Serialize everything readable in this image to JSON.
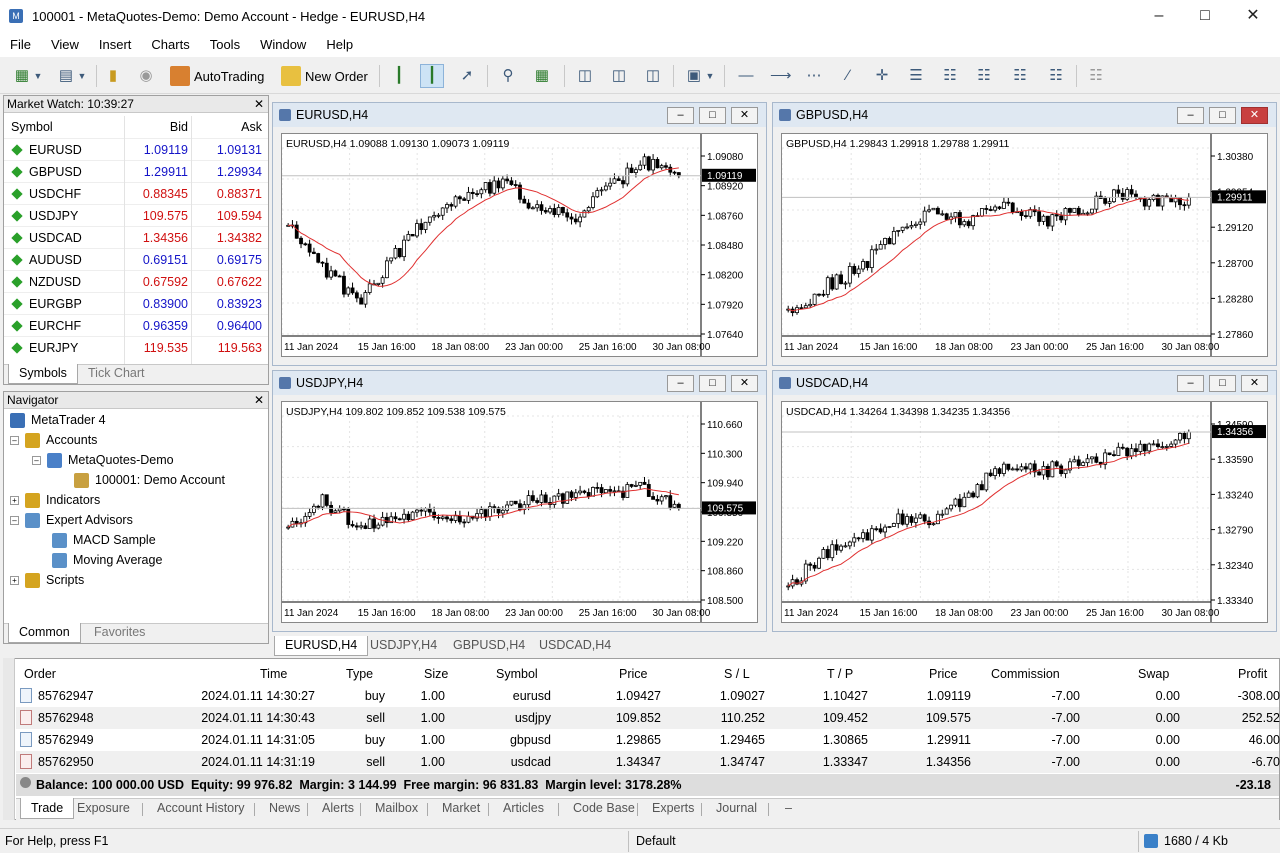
{
  "window": {
    "title": "100001 - MetaQuotes-Demo: Demo Account - Hedge - EURUSD,H4"
  },
  "menu": [
    "File",
    "View",
    "Insert",
    "Charts",
    "Tools",
    "Window",
    "Help"
  ],
  "toolbar": {
    "autotrading": "AutoTrading",
    "new_order": "New Order"
  },
  "market_watch": {
    "title": "Market Watch: 10:39:27",
    "headers": {
      "symbol": "Symbol",
      "bid": "Bid",
      "ask": "Ask"
    },
    "rows": [
      {
        "symbol": "EURUSD",
        "bid": "1.09119",
        "ask": "1.09131",
        "dir": "blue"
      },
      {
        "symbol": "GBPUSD",
        "bid": "1.29911",
        "ask": "1.29934",
        "dir": "blue"
      },
      {
        "symbol": "USDCHF",
        "bid": "0.88345",
        "ask": "0.88371",
        "dir": "red"
      },
      {
        "symbol": "USDJPY",
        "bid": "109.575",
        "ask": "109.594",
        "dir": "red"
      },
      {
        "symbol": "USDCAD",
        "bid": "1.34356",
        "ask": "1.34382",
        "dir": "red"
      },
      {
        "symbol": "AUDUSD",
        "bid": "0.69151",
        "ask": "0.69175",
        "dir": "blue"
      },
      {
        "symbol": "NZDUSD",
        "bid": "0.67592",
        "ask": "0.67622",
        "dir": "red"
      },
      {
        "symbol": "EURGBP",
        "bid": "0.83900",
        "ask": "0.83923",
        "dir": "blue"
      },
      {
        "symbol": "EURCHF",
        "bid": "0.96359",
        "ask": "0.96400",
        "dir": "blue"
      },
      {
        "symbol": "EURJPY",
        "bid": "119.535",
        "ask": "119.563",
        "dir": "red"
      }
    ],
    "tabs": [
      "Symbols",
      "Tick Chart"
    ]
  },
  "navigator": {
    "title": "Navigator",
    "items": [
      "MetaTrader 4",
      "Accounts",
      "MetaQuotes-Demo",
      "100001: Demo Account",
      "Indicators",
      "Expert Advisors",
      "MACD Sample",
      "Moving Average",
      "Scripts"
    ],
    "tabs": [
      "Common",
      "Favorites"
    ]
  },
  "charts": [
    {
      "name": "EURUSD,H4",
      "info": "EURUSD,H4  1.09088 1.09130 1.09073 1.09119",
      "ticks": [
        "1.09080",
        "1.08920",
        "1.08760",
        "1.08480",
        "1.08200",
        "1.07920",
        "1.07640"
      ],
      "price": "1.09119",
      "ymin": 1.0764,
      "ymax": 1.0938,
      "start": 1.0848,
      "end": 1.0912,
      "path": [
        0.3,
        -0.4,
        -0.9,
        -0.2,
        0.5,
        0.8,
        1.0,
        0.6,
        0.4,
        0.9,
        1.3,
        1.1
      ],
      "dates": [
        "11 Jan 2024",
        "15 Jan 16:00",
        "18 Jan 08:00",
        "23 Jan 00:00",
        "25 Jan 16:00",
        "30 Jan 08:00"
      ]
    },
    {
      "name": "GBPUSD,H4",
      "info": "GBPUSD,H4  1.29843 1.29918 1.29788 1.29911",
      "ticks": [
        "1.30380",
        "1.29954",
        "1.29120",
        "1.28700",
        "1.28280",
        "1.27860"
      ],
      "price": "1.29911",
      "ymin": 1.2786,
      "ymax": 1.3065,
      "start": 1.2815,
      "end": 1.2991,
      "path": [
        0.0,
        0.3,
        0.5,
        0.9,
        1.1,
        1.0,
        1.2,
        1.0,
        1.1,
        1.3,
        1.2,
        1.25
      ],
      "dates": [
        "11 Jan 2024",
        "15 Jan 16:00",
        "18 Jan 08:00",
        "23 Jan 00:00",
        "25 Jan 16:00",
        "30 Jan 08:00"
      ]
    },
    {
      "name": "USDJPY,H4",
      "info": "USDJPY,H4  109.802 109.852 109.538 109.575",
      "ticks": [
        "110.660",
        "110.300",
        "109.940",
        "109.350",
        "109.220",
        "108.860",
        "108.500"
      ],
      "price": "109.575",
      "ymin": 108.5,
      "ymax": 110.66,
      "start": 109.25,
      "end": 109.575,
      "path": [
        0.3,
        0.9,
        0.2,
        0.5,
        0.6,
        0.5,
        0.7,
        0.9,
        1.0,
        1.1,
        1.2,
        0.7
      ],
      "dates": [
        "11 Jan 2024",
        "15 Jan 16:00",
        "18 Jan 08:00",
        "23 Jan 00:00",
        "25 Jan 16:00",
        "30 Jan 08:00"
      ]
    },
    {
      "name": "USDCAD,H4",
      "info": "USDCAD,H4  1.34264 1.34398 1.34235 1.34356",
      "ticks": [
        "1.34590",
        "1.33590",
        "1.33240",
        "1.32790",
        "1.32340",
        "1.33340"
      ],
      "price": "1.34356",
      "ymin": 1.3195,
      "ymax": 1.3459,
      "start": 1.3215,
      "end": 1.3436,
      "path": [
        0.0,
        0.2,
        0.3,
        0.45,
        0.4,
        0.6,
        0.8,
        0.75,
        0.8,
        0.85,
        0.9,
        1.0
      ],
      "dates": [
        "11 Jan 2024",
        "15 Jan 16:00",
        "18 Jan 08:00",
        "23 Jan 00:00",
        "25 Jan 16:00",
        "30 Jan 08:00"
      ]
    }
  ],
  "chart_tabs": [
    "EURUSD,H4",
    "USDJPY,H4",
    "GBPUSD,H4",
    "USDCAD,H4"
  ],
  "terminal": {
    "headers": [
      "Order",
      "Time",
      "Type",
      "Size",
      "Symbol",
      "Price",
      "S / L",
      "T / P",
      "Price",
      "Commission",
      "Swap",
      "Profit"
    ],
    "rows": [
      [
        "85762947",
        "2024.01.11 14:30:27",
        "buy",
        "1.00",
        "eurusd",
        "1.09427",
        "1.09027",
        "1.10427",
        "1.09119",
        "-7.00",
        "0.00",
        "-308.00"
      ],
      [
        "85762948",
        "2024.01.11 14:30:43",
        "sell",
        "1.00",
        "usdjpy",
        "109.852",
        "110.252",
        "109.452",
        "109.575",
        "-7.00",
        "0.00",
        "252.52"
      ],
      [
        "85762949",
        "2024.01.11 14:31:05",
        "buy",
        "1.00",
        "gbpusd",
        "1.29865",
        "1.29465",
        "1.30865",
        "1.29911",
        "-7.00",
        "0.00",
        "46.00"
      ],
      [
        "85762950",
        "2024.01.11 14:31:19",
        "sell",
        "1.00",
        "usdcad",
        "1.34347",
        "1.34747",
        "1.33347",
        "1.34356",
        "-7.00",
        "0.00",
        "-6.70"
      ]
    ],
    "balance": "Balance: 100 000.00 USD  Equity: 99 976.82  Margin: 3 144.99  Free margin: 96 831.83  Margin level: 3178.28%",
    "total": "-23.18",
    "tabs": [
      "Trade",
      "Exposure",
      "Account History",
      "News",
      "Alerts",
      "Mailbox",
      "Market",
      "Articles",
      "Code Base",
      "Experts",
      "Journal"
    ]
  },
  "status": {
    "help": "For Help, press F1",
    "profile": "Default",
    "traffic": "1680 / 4 Kb"
  }
}
